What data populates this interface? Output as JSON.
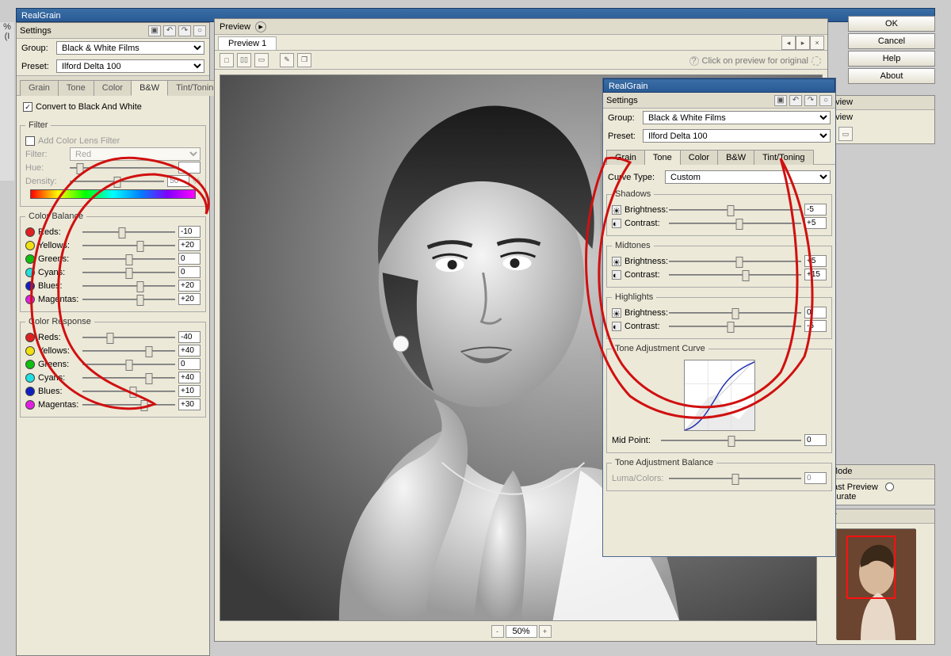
{
  "app_title": "RealGrain",
  "left_sliver": "% (I",
  "left": {
    "header": "Settings",
    "group_label": "Group:",
    "group_value": "Black & White Films",
    "preset_label": "Preset:",
    "preset_value": "Ilford Delta 100",
    "tabs": [
      "Grain",
      "Tone",
      "Color",
      "B&W",
      "Tint/Toning"
    ],
    "active_tab": "B&W",
    "convert_label": "Convert to Black And White",
    "filter_legend": "Filter",
    "add_color_label": "Add Color Lens Filter",
    "filter_label": "Filter:",
    "filter_value": "Red",
    "hue_label": "Hue:",
    "density_label": "Density:",
    "density_value": "50",
    "density_suffix": "%",
    "color_balance": {
      "legend": "Color Balance",
      "rows": [
        {
          "name": "Reds:",
          "color": "#e02020",
          "value": "-10",
          "pos": 43
        },
        {
          "name": "Yellows:",
          "color": "#f0e010",
          "value": "+20",
          "pos": 62
        },
        {
          "name": "Greens:",
          "color": "#10c010",
          "value": "0",
          "pos": 50
        },
        {
          "name": "Cyans:",
          "color": "#20e0e0",
          "value": "0",
          "pos": 50
        },
        {
          "name": "Blues:",
          "color": "#1020c0",
          "value": "+20",
          "pos": 62
        },
        {
          "name": "Magentas:",
          "color": "#e020e0",
          "value": "+20",
          "pos": 62
        }
      ]
    },
    "color_response": {
      "legend": "Color Response",
      "rows": [
        {
          "name": "Reds:",
          "color": "#e02020",
          "value": "-40",
          "pos": 30
        },
        {
          "name": "Yellows:",
          "color": "#f0e010",
          "value": "+40",
          "pos": 72
        },
        {
          "name": "Greens:",
          "color": "#10c010",
          "value": "0",
          "pos": 50
        },
        {
          "name": "Cyans:",
          "color": "#20e0e0",
          "value": "+40",
          "pos": 72
        },
        {
          "name": "Blues:",
          "color": "#1020c0",
          "value": "+10",
          "pos": 55
        },
        {
          "name": "Magentas:",
          "color": "#e020e0",
          "value": "+30",
          "pos": 67
        }
      ]
    }
  },
  "preview": {
    "header": "Preview",
    "tab": "Preview 1",
    "hint": "Click on preview for original",
    "zoom": "50%"
  },
  "sub": {
    "title": "RealGrain",
    "header": "Settings",
    "group_label": "Group:",
    "group_value": "Black & White Films",
    "preset_label": "Preset:",
    "preset_value": "Ilford Delta 100",
    "tabs": [
      "Grain",
      "Tone",
      "Color",
      "B&W",
      "Tint/Toning"
    ],
    "active_tab": "Tone",
    "curve_type_label": "Curve Type:",
    "curve_type_value": "Custom",
    "shadows": {
      "legend": "Shadows",
      "brightness_label": "Brightness:",
      "brightness_value": "-5",
      "contrast_label": "Contrast:",
      "contrast_value": "+5"
    },
    "midtones": {
      "legend": "Midtones",
      "brightness_label": "Brightness:",
      "brightness_value": "+5",
      "contrast_label": "Contrast:",
      "contrast_value": "+15"
    },
    "highlights": {
      "legend": "Highlights",
      "brightness_label": "Brightness:",
      "brightness_value": "0",
      "contrast_label": "Contrast:",
      "contrast_value": "-5"
    },
    "curve_legend": "Tone Adjustment Curve",
    "midpoint_label": "Mid Point:",
    "midpoint_value": "0",
    "balance_legend": "Tone Adjustment Balance",
    "luma_label": "Luma/Colors:",
    "luma_value": "0"
  },
  "buttons": {
    "ok": "OK",
    "cancel": "Cancel",
    "help": "Help",
    "about": "About"
  },
  "right": {
    "preview_hdr": "Preview",
    "preview_label": "Preview",
    "mode_hdr": "w Mode",
    "fast_label": "ast Preview",
    "accurate_label": "Accurate",
    "nav_hdr": "ator"
  }
}
